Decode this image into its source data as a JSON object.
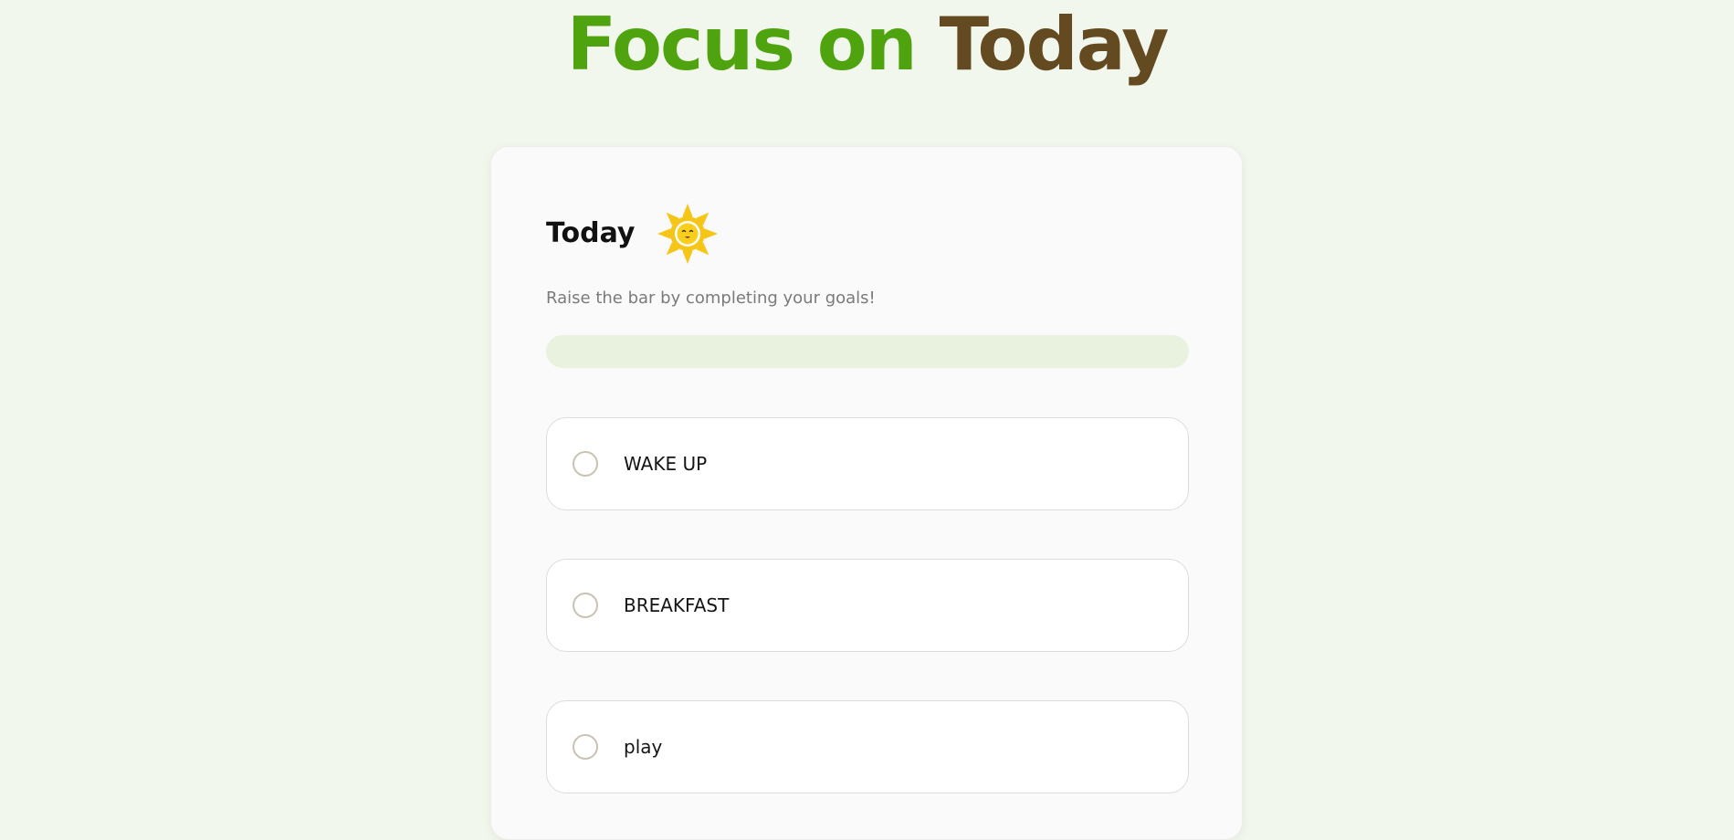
{
  "app": {
    "title_part1": "Focus on",
    "title_part2": "Today"
  },
  "card": {
    "heading": "Today",
    "heading_icon": "sun-icon",
    "subtitle": "Raise the bar by completing your goals!",
    "progress_fraction": 0
  },
  "goals": [
    {
      "label": "WAKE UP",
      "completed": false
    },
    {
      "label": "BREAKFAST",
      "completed": false
    },
    {
      "label": "play",
      "completed": false
    }
  ],
  "colors": {
    "background": "#f1f7ec",
    "title_green": "#4ea30e",
    "title_brown": "#634a21",
    "progress_track": "#e8f2df",
    "sun_yellow": "#f5c518",
    "checkbox_border": "#c9c2b3"
  }
}
